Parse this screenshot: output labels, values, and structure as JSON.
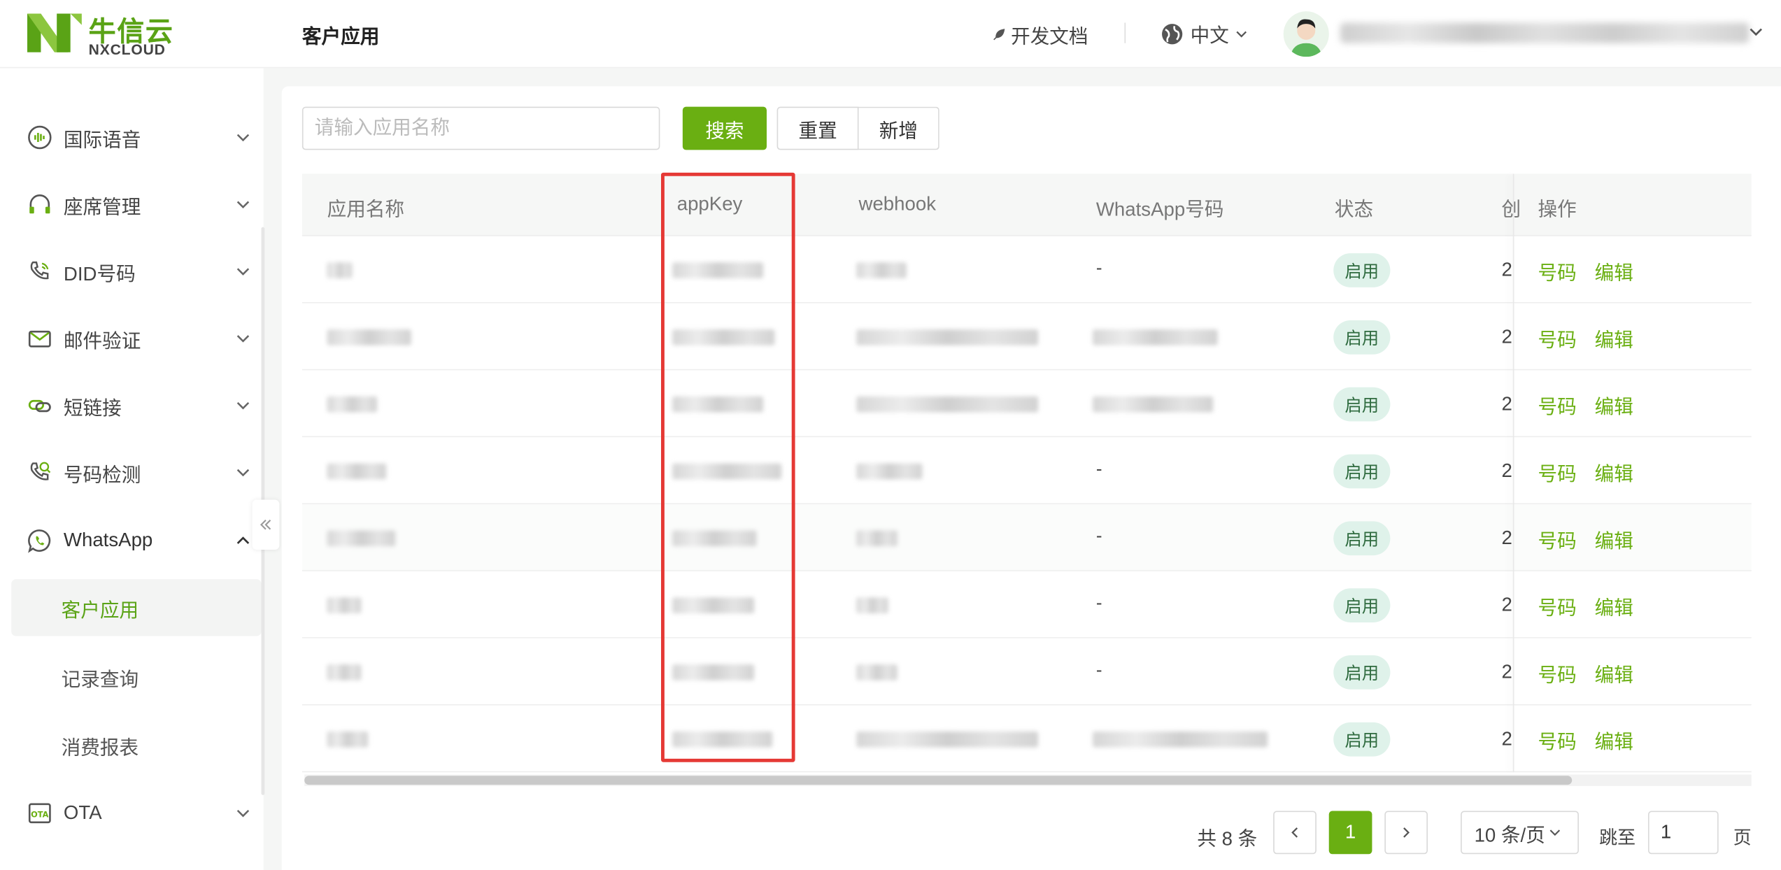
{
  "brand": {
    "name_cn": "牛信云",
    "name_en": "NXCLOUD",
    "color": "#5aa316"
  },
  "header": {
    "page_title": "客户应用",
    "docs_label": "开发文档",
    "lang_label": "中文",
    "user_label": ""
  },
  "sidebar": {
    "items": [
      {
        "label": "国际语音",
        "icon": "voice-wave-icon",
        "expanded": false
      },
      {
        "label": "座席管理",
        "icon": "headset-icon",
        "expanded": false
      },
      {
        "label": "DID号码",
        "icon": "phone-icon",
        "expanded": false
      },
      {
        "label": "邮件验证",
        "icon": "mail-icon",
        "expanded": false
      },
      {
        "label": "短链接",
        "icon": "link-icon",
        "expanded": false
      },
      {
        "label": "号码检测",
        "icon": "phone-check-icon",
        "expanded": false
      },
      {
        "label": "WhatsApp",
        "icon": "whatsapp-icon",
        "expanded": true
      },
      {
        "label": "OTA",
        "icon": "ota-icon",
        "expanded": false
      }
    ],
    "whatsapp_children": [
      {
        "label": "客户应用",
        "active": true
      },
      {
        "label": "记录查询",
        "active": false
      },
      {
        "label": "消费报表",
        "active": false
      }
    ]
  },
  "toolbar": {
    "search_placeholder": "请输入应用名称",
    "search_label": "搜索",
    "reset_label": "重置",
    "add_label": "新增"
  },
  "table": {
    "columns": [
      "应用名称",
      "appKey",
      "webhook",
      "WhatsApp号码",
      "状态",
      "创",
      "操作"
    ],
    "rows": [
      {
        "whatsapp": "-",
        "status": "启用",
        "created": "2",
        "op1": "号码",
        "op2": "编辑"
      },
      {
        "whatsapp": "",
        "status": "启用",
        "created": "2",
        "op1": "号码",
        "op2": "编辑"
      },
      {
        "whatsapp": "",
        "status": "启用",
        "created": "2",
        "op1": "号码",
        "op2": "编辑"
      },
      {
        "whatsapp": "-",
        "status": "启用",
        "created": "2",
        "op1": "号码",
        "op2": "编辑"
      },
      {
        "whatsapp": "-",
        "status": "启用",
        "created": "2",
        "op1": "号码",
        "op2": "编辑"
      },
      {
        "whatsapp": "-",
        "status": "启用",
        "created": "2",
        "op1": "号码",
        "op2": "编辑"
      },
      {
        "whatsapp": "-",
        "status": "启用",
        "created": "2",
        "op1": "号码",
        "op2": "编辑"
      },
      {
        "whatsapp": "",
        "status": "启用",
        "created": "2",
        "op1": "号码",
        "op2": "编辑"
      }
    ]
  },
  "pagination": {
    "total_label": "共 8 条",
    "current_page": "1",
    "page_size_label": "10 条/页",
    "jump_label": "跳至",
    "jump_value": "1",
    "page_suffix": "页"
  },
  "colors": {
    "primary": "#6aaf12",
    "highlight": "#e53935",
    "badge_bg": "#dff2ea"
  }
}
